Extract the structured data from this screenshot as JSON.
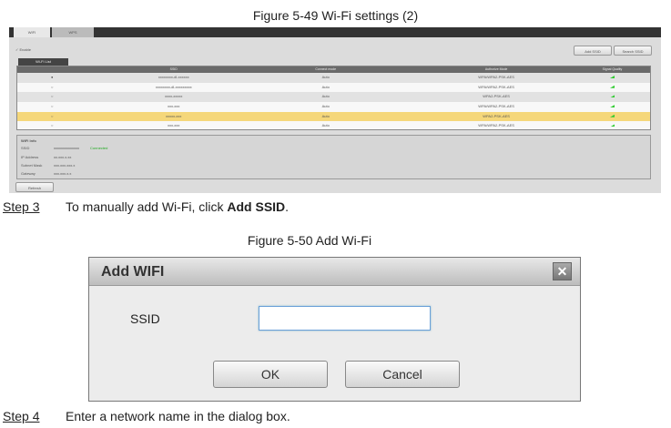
{
  "figure1": {
    "caption": "Figure 5-49 Wi-Fi settings (2)",
    "tabs": [
      "WIFI",
      "WPS"
    ],
    "enable_label": "Enable",
    "add_ssid": "Add SSID",
    "search_ssid": "Search SSID",
    "list_tab": "Wi-Fi List",
    "columns": [
      "",
      "SSID",
      "Connect mode",
      "Authorize Mode",
      "Signal Quality"
    ],
    "rows": [
      {
        "ssid": "xxxxxxxx-dl-xxxxxx",
        "mode": "Auto",
        "auth": "WPA/WPA2-PSK-AES"
      },
      {
        "ssid": "xxxxxxxx-dl-xxxxxxxxx",
        "mode": "Auto",
        "auth": "WPA/WPA2-PSK-AES"
      },
      {
        "ssid": "xxxx-xxxxx",
        "mode": "Auto",
        "auth": "WPA2-PSK-AES"
      },
      {
        "ssid": "xxx-xxx",
        "mode": "Auto",
        "auth": "WPA/WPA2-PSK-AES"
      },
      {
        "ssid": "xxxxx-xxx",
        "mode": "Auto",
        "auth": "WPA2-PSK-AES"
      },
      {
        "ssid": "xxx-xxx",
        "mode": "Auto",
        "auth": "WPA/WPA2-PSK-AES"
      }
    ],
    "info": {
      "title": "WiFi Info",
      "ssid_label": "SSID",
      "ssid_value": "xxxxxxxxxxxxxx",
      "status": "Connected",
      "ip_label": "IP Address",
      "ip": "xx.xxx.x.xx",
      "mask_label": "Subnet Mask",
      "mask": "xxx.xxx.xxx.x",
      "gw_label": "Gateway",
      "gw": "xxx.xxx.x.x"
    },
    "refresh": "Refresh"
  },
  "step3": {
    "label": "Step 3",
    "text": "To manually add Wi-Fi, click ",
    "bold": "Add SSID",
    "end": "."
  },
  "figure2": {
    "caption": "Figure 5-50 Add Wi-Fi",
    "title": "Add WIFI",
    "close": "✕",
    "ssid_label": "SSID",
    "ssid_value": "",
    "ok": "OK",
    "cancel": "Cancel"
  },
  "step4": {
    "label": "Step 4",
    "text": "Enter a network name in the dialog box."
  }
}
